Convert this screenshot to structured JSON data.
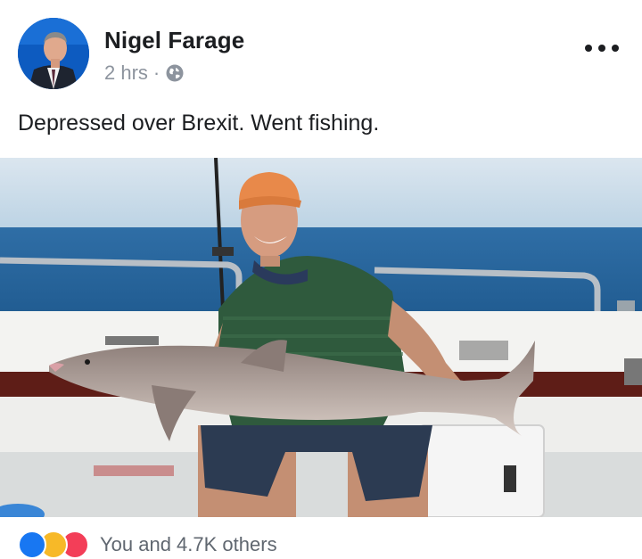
{
  "post": {
    "author": "Nigel Farage",
    "time": "2 hrs",
    "separator": "·",
    "audience_icon": "globe-icon",
    "text": "Depressed over Brexit. Went fishing.",
    "reactions_summary": "You and 4.7K others"
  },
  "reactions": [
    "like-icon",
    "haha-icon",
    "love-icon"
  ],
  "colors": {
    "name": "#1c1e21",
    "meta": "#8d949e",
    "like": "#1877f2",
    "haha": "#f7b928",
    "love": "#f33e58"
  }
}
